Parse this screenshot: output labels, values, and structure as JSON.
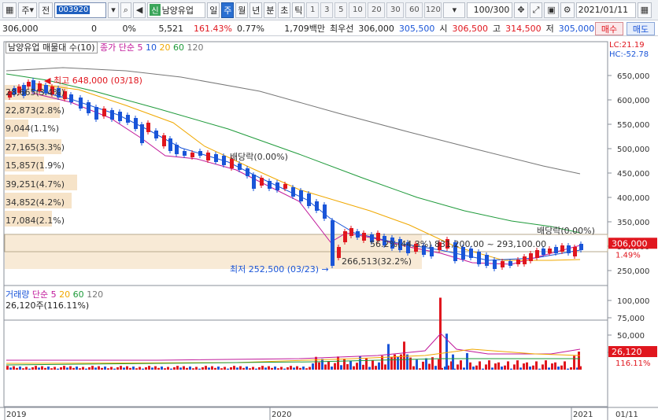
{
  "toolbar": {
    "market": "주",
    "pre": "전",
    "code": "003920",
    "stock_name": "남양유업",
    "credit_badge": "신",
    "periods": [
      "일",
      "주",
      "월",
      "년",
      "분",
      "초",
      "틱"
    ],
    "active_period": "주",
    "intervals": [
      "1",
      "3",
      "5",
      "10",
      "20",
      "30",
      "60",
      "120"
    ],
    "zoom": "100/300",
    "date": "2021/01/11"
  },
  "quote": {
    "price": "306,000",
    "change": "0",
    "change_rate": "0%",
    "volume": "5,521",
    "volume_rate": "161.43%",
    "turnover": "0.77%",
    "amount": "1,709백만",
    "lowest_label": "최우선",
    "lowest": "306,000",
    "ask": "305,500",
    "open_label": "시",
    "open": "306,500",
    "high_label": "고",
    "high": "314,500",
    "low_label": "저",
    "low": "305,000",
    "buy": "매수",
    "sell": "매도"
  },
  "price_panel": {
    "legend_title": "남양유업 매물대 수(10)",
    "ma_label": "종가 단순",
    "ma_periods": [
      "5",
      "10",
      "20",
      "60",
      "120"
    ],
    "lc": "LC:21.19",
    "hc": "HC:-52.78",
    "high_note": "최고 648,000 (03/18)",
    "low_note": "최저 252,500 (03/23)",
    "dividend1": "배당락(0.00%)",
    "dividend2": "배당락(0.00%)",
    "range_note": "56.2%(44.3%) 831,200.00 ~ 293,100.00",
    "volume_profile_labels": [
      "28,665(3.4%)",
      "22,873(2.8%)",
      "9,044(1.1%)",
      "27,165(3.3%)",
      "15,857(1.9%)",
      "39,251(4.7%)",
      "34,852(4.2%)",
      "17,084(2.1%)",
      "266,513(32.2%)"
    ],
    "y_ticks": [
      "650,000",
      "600,000",
      "550,000",
      "500,000",
      "450,000",
      "400,000",
      "350,000",
      "300,000",
      "250,000"
    ],
    "current_price": "306,000",
    "current_rate": "1.49%"
  },
  "volume_panel": {
    "legend_title": "거래량",
    "ma_label": "단순",
    "ma_periods": [
      "5",
      "20",
      "60",
      "120"
    ],
    "value_note": "26,120주(116.11%)",
    "y_ticks": [
      "100,000",
      "75,000",
      "50,000",
      "25,000"
    ],
    "current_volume": "26,120",
    "current_rate": "116.11%"
  },
  "x_axis": {
    "labels": [
      "2019",
      "2020",
      "2021"
    ],
    "right_label": "01/11"
  },
  "colors": {
    "up": "#e0161e",
    "down": "#1a55d8",
    "ma5": "#c0189a",
    "ma10": "#1a55d8",
    "ma20": "#f0a800",
    "ma60": "#1e9a3a",
    "ma120": "#777777",
    "profile": "#f6e3c8"
  }
}
